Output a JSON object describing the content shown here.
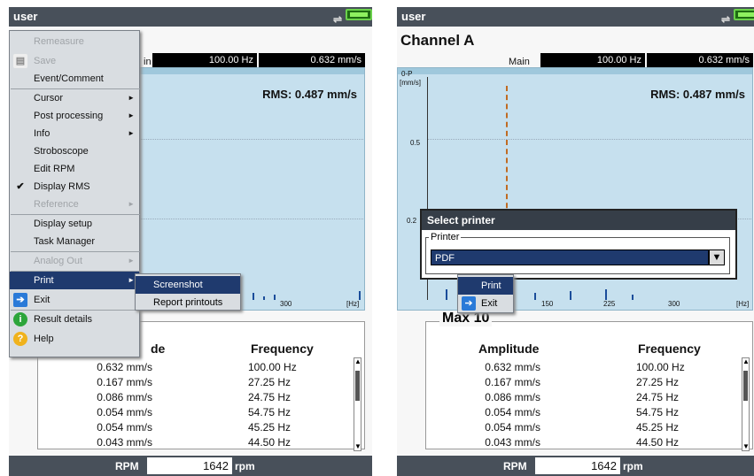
{
  "user": "user",
  "channel_title": "Channel A",
  "header": {
    "main_label": "Main",
    "freq_value": "100.00 Hz",
    "amp_value": "0.632 mm/s"
  },
  "chart": {
    "rms_label": "RMS: 0.487 mm/s",
    "y_unit_top": "0-P",
    "y_unit": "[mm/s]",
    "y_tick_05": "0.5",
    "y_tick_02": "0.2",
    "x_ticks": [
      "150",
      "225",
      "300"
    ],
    "x_unit": "[Hz]"
  },
  "table": {
    "title": "Max 10",
    "col_amplitude": "Amplitude",
    "col_amplitude_partial": "de",
    "col_frequency": "Frequency",
    "rows": [
      {
        "amp": "0.632 mm/s",
        "freq": "100.00 Hz"
      },
      {
        "amp": "0.167 mm/s",
        "freq": "27.25 Hz"
      },
      {
        "amp": "0.086 mm/s",
        "freq": "24.75 Hz"
      },
      {
        "amp": "0.054 mm/s",
        "freq": "54.75 Hz"
      },
      {
        "amp": "0.054 mm/s",
        "freq": "45.25 Hz"
      },
      {
        "amp": "0.043 mm/s",
        "freq": "44.50 Hz"
      }
    ]
  },
  "rpm": {
    "label": "RPM",
    "value": "1642",
    "unit": "rpm"
  },
  "menu": {
    "items": [
      {
        "label": "Remeasure"
      },
      {
        "label": "Save"
      },
      {
        "label": "Event/Comment"
      },
      {
        "label": "Cursor"
      },
      {
        "label": "Post processing"
      },
      {
        "label": "Info"
      },
      {
        "label": "Stroboscope"
      },
      {
        "label": "Edit RPM"
      },
      {
        "label": "Display RMS"
      },
      {
        "label": "Reference"
      },
      {
        "label": "Display setup"
      },
      {
        "label": "Task Manager"
      },
      {
        "label": "Analog Out"
      },
      {
        "label": "Print"
      },
      {
        "label": "Exit"
      },
      {
        "label": "Result details"
      },
      {
        "label": "Help"
      }
    ],
    "submenu": [
      "Screenshot",
      "Report printouts"
    ],
    "partial_left_tick": "[r",
    "header_partial": "in"
  },
  "dialog": {
    "title": "Select printer",
    "printer_label": "Printer",
    "selected": "PDF",
    "dropdown_arrow": "▼"
  },
  "print_menu": {
    "print": "Print",
    "exit": "Exit"
  },
  "icons": {
    "plug": "⇌",
    "check": "✔",
    "submenu_arrow": "►",
    "scroll_up": "▲",
    "scroll_down": "▼"
  }
}
